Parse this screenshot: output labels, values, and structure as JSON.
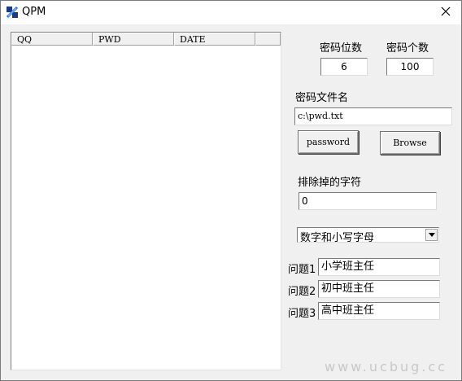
{
  "window": {
    "title": "QPM",
    "app_icon": "qpm-app-icon",
    "close_icon": "close-icon"
  },
  "list": {
    "columns": [
      "QQ",
      "PWD",
      "DATE",
      ""
    ],
    "rows": []
  },
  "password_length": {
    "label": "密码位数",
    "value": "6"
  },
  "password_count": {
    "label": "密码个数",
    "value": "100"
  },
  "password_file": {
    "label": "密码文件名",
    "value": "c:\\pwd.txt"
  },
  "buttons": {
    "password": "password",
    "browse": "Browse"
  },
  "exclude_chars": {
    "label": "排除掉的字符",
    "value": "0"
  },
  "charset": {
    "selected": "数字和小写字母"
  },
  "questions": [
    {
      "label": "问题1",
      "value": "小学班主任"
    },
    {
      "label": "问题2",
      "value": "初中班主任"
    },
    {
      "label": "问题3",
      "value": "高中班主任"
    }
  ],
  "watermark": "www.ucbug.cc"
}
